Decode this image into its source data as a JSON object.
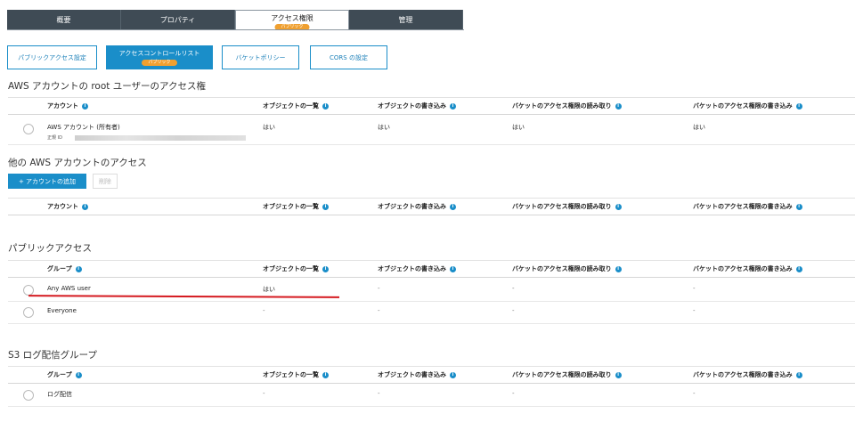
{
  "tabs": {
    "overview": "概要",
    "properties": "プロパティ",
    "permissions": "アクセス権限",
    "permissions_badge": "パブリック",
    "management": "管理"
  },
  "subtabs": {
    "public_access": "パブリックアクセス設定",
    "acl": "アクセスコントロールリスト",
    "acl_badge": "パブリック",
    "bucket_policy": "バケットポリシー",
    "cors": "CORS の設定"
  },
  "columns": {
    "account": "アカウント",
    "group": "グループ",
    "list_objects": "オブジェクトの一覧",
    "write_objects": "オブジェクトの書き込み",
    "read_bucket_perms": "バケットのアクセス権限の読み取り",
    "write_bucket_perms": "バケットのアクセス権限の書き込み"
  },
  "root_section": {
    "title": "AWS アカウントの root ユーザーのアクセス権",
    "account_name": "AWS アカウント (所有者)",
    "canonical_label": "正規 ID",
    "list": "はい",
    "write": "はい",
    "read_perm": "はい",
    "write_perm": "はい"
  },
  "other_section": {
    "title": "他の AWS アカウントのアクセス",
    "add_label": "+ アカウントの追加",
    "delete_label": "削除"
  },
  "public_section": {
    "title": "パブリックアクセス",
    "rows": [
      {
        "name": "Any AWS user",
        "list": "はい",
        "write": "-",
        "read_perm": "-",
        "write_perm": "-"
      },
      {
        "name": "Everyone",
        "list": "-",
        "write": "-",
        "read_perm": "-",
        "write_perm": "-"
      }
    ]
  },
  "s3log_section": {
    "title": "S3 ログ配信グループ",
    "rows": [
      {
        "name": "ログ配信",
        "list": "-",
        "write": "-",
        "read_perm": "-",
        "write_perm": "-"
      }
    ]
  },
  "info_glyph": "i",
  "colors": {
    "accent": "#1a8ec9",
    "badge": "#f0a030",
    "tab_dark": "#3f4b55",
    "annotation_red": "#d51a20"
  }
}
